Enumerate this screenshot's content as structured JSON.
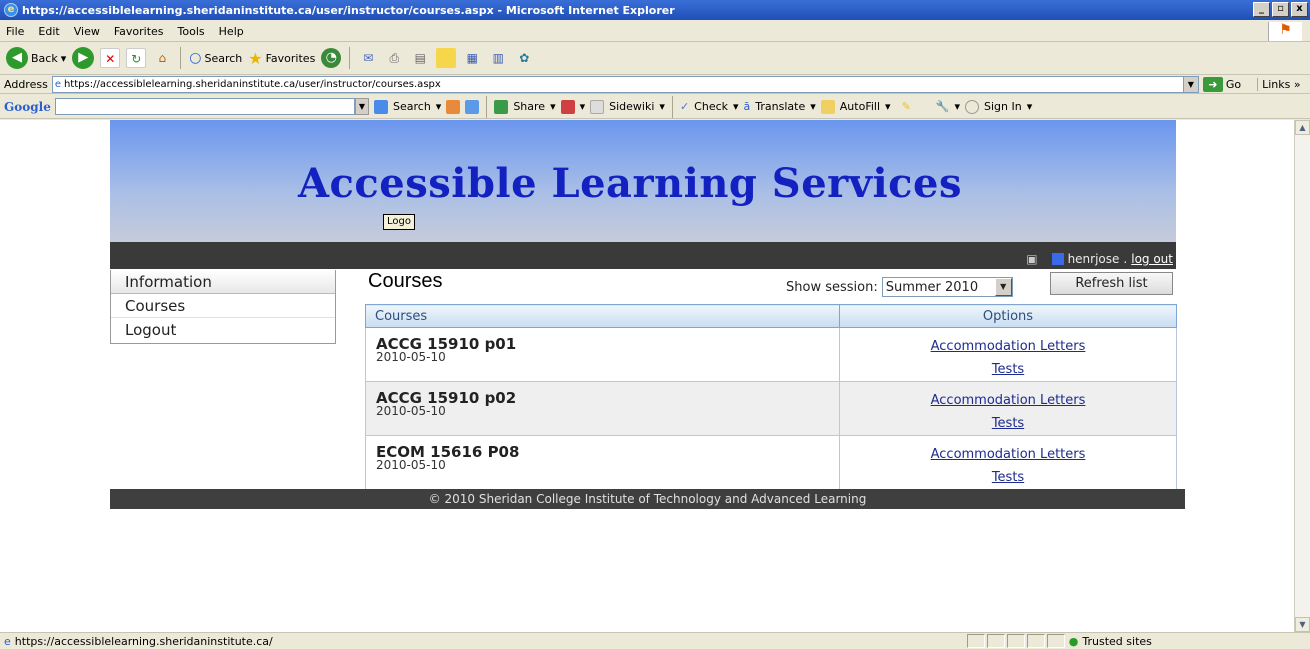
{
  "window": {
    "title": "https://accessiblelearning.sheridaninstitute.ca/user/instructor/courses.aspx - Microsoft Internet Explorer",
    "min": "_",
    "max": "▫",
    "close": "x"
  },
  "menu": [
    "File",
    "Edit",
    "View",
    "Favorites",
    "Tools",
    "Help"
  ],
  "toolbar": {
    "back": "Back",
    "search": "Search",
    "favorites": "Favorites"
  },
  "address": {
    "label": "Address",
    "url": "https://accessiblelearning.sheridaninstitute.ca/user/instructor/courses.aspx",
    "go": "Go",
    "links": "Links »"
  },
  "google": {
    "logo": "Google",
    "search": "Search",
    "share": "Share",
    "sidewiki": "Sidewiki",
    "check": "Check",
    "translate": "Translate",
    "autofill": "AutoFill",
    "signin": "Sign In"
  },
  "page": {
    "site_title": "Accessible Learning Services",
    "logo": "Logo",
    "user": "henrjose",
    "logout": "log out",
    "nav": [
      "Information",
      "Courses",
      "Logout"
    ],
    "heading": "Courses",
    "session_label": "Show session:",
    "session_value": "Summer 2010",
    "refresh": "Refresh list",
    "col_courses": "Courses",
    "col_options": "Options",
    "rows": [
      {
        "code": "ACCG 15910 p01",
        "date": "2010-05-10",
        "link1": "Accommodation Letters",
        "link2": "Tests"
      },
      {
        "code": "ACCG 15910 p02",
        "date": "2010-05-10",
        "link1": "Accommodation Letters",
        "link2": "Tests"
      },
      {
        "code": "ECOM 15616 P08",
        "date": "2010-05-10",
        "link1": "Accommodation Letters",
        "link2": "Tests"
      }
    ],
    "footer": "© 2010 Sheridan College Institute of Technology and Advanced Learning"
  },
  "status": {
    "url": "https://accessiblelearning.sheridaninstitute.ca/",
    "zone": "Trusted sites"
  }
}
